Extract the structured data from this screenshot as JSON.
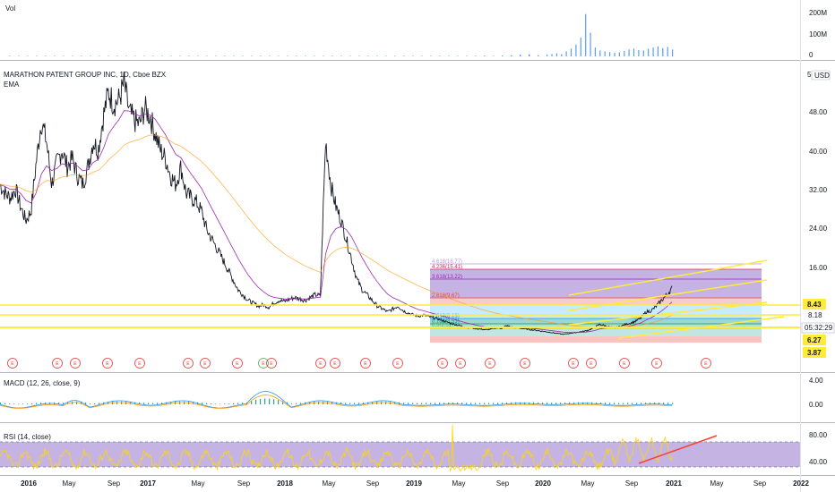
{
  "chart_data": [
    {
      "type": "bar",
      "panel": "volume",
      "legend": "Vol",
      "y_ticks": [
        "200M",
        "100M",
        "0"
      ],
      "ylim": [
        0,
        250
      ],
      "colors": {
        "bar": "#5b9cf6"
      },
      "series": [
        {
          "values": [
            0.5,
            0.6,
            0.4,
            0.5,
            0.3,
            0.4,
            0.6,
            0.5,
            0.4,
            0.3,
            0.4,
            0.5,
            0.6,
            0.7,
            0.5,
            0.4,
            0.3,
            0.4,
            0.5,
            0.6,
            0.5,
            0.4,
            0.8,
            1.2,
            0.9,
            0.6,
            0.5,
            0.4,
            0.3,
            0.4,
            0.5,
            0.6,
            0.5,
            0.4,
            0.3,
            0.5,
            0.6,
            0.7,
            0.5,
            0.4,
            0.6,
            1.0,
            1.8,
            2.5,
            1.2,
            0.8,
            0.6,
            0.5,
            0.8,
            1.1,
            0.9,
            1.5,
            2.0,
            3.0,
            2.2,
            4.0,
            6.0,
            8.0,
            10.0,
            6.0,
            9.0,
            12.0,
            15.0,
            11.0,
            25.0,
            40.0,
            60.0,
            95.0,
            215.0,
            120.0,
            45.0,
            30.0,
            25.0,
            22.0,
            18.0,
            20.0,
            28.0,
            35.0,
            40.0,
            32.0,
            30.0,
            38.0,
            45.0,
            50.0,
            42.0,
            48.0,
            35.0
          ]
        }
      ]
    },
    {
      "type": "line",
      "panel": "price",
      "title": "MARATHON PATENT GROUP INC, 1D, Cboe BZX",
      "legend": [
        "EMA"
      ],
      "currency": "USD",
      "y_ticks": [
        "5",
        "48.00",
        "40.00",
        "32.00",
        "24.00",
        "16.00",
        "8.43",
        "8.18",
        "05:32:29",
        "6.27",
        "3.87"
      ],
      "x_ticks": [
        "2016",
        "May",
        "Sep",
        "2017",
        "May",
        "Sep",
        "2018",
        "May",
        "Sep",
        "2019",
        "May",
        "Sep",
        "2020",
        "May",
        "Sep",
        "2021",
        "May",
        "Sep",
        "2022"
      ],
      "price_badges": {
        "upper": "8.43",
        "current": "8.18",
        "countdown": "05:32:29",
        "lower1": "6.27",
        "lower2": "3.87"
      },
      "horizontal_lines": [
        8.43,
        6.27,
        3.87
      ],
      "fib_levels": [
        {
          "label": "4.618(16.77)",
          "color": "#b39ddb"
        },
        {
          "label": "4.236(15.41)",
          "color": "#e91e63"
        },
        {
          "label": "3.618(13.22)",
          "color": "#9c27b0"
        },
        {
          "label": "2.618(9.67)",
          "color": "#f44336"
        },
        {
          "label": "1.618(6.13)",
          "color": "#2196f3"
        },
        {
          "label": "0.786(3.53)",
          "color": "#009688"
        },
        {
          "label": "0.5(2.51)",
          "color": "#4caf50"
        }
      ],
      "earnings_marker": "E",
      "series": [
        {
          "values": [
            30,
            28,
            27,
            29,
            25,
            22,
            24,
            35,
            45,
            40,
            30,
            35,
            38,
            34,
            36,
            32,
            30,
            34,
            40,
            38,
            46,
            52,
            49,
            50,
            54,
            47,
            45,
            44,
            48,
            46,
            42,
            38,
            36,
            32,
            30,
            34,
            28,
            27,
            26,
            24,
            20,
            18,
            16,
            14,
            12,
            10,
            8,
            7,
            6,
            5.5,
            5,
            5.2,
            4.8,
            5.5,
            6,
            5.8,
            6.2,
            6.5,
            6.3,
            6,
            6.5,
            7,
            6.8,
            40,
            30,
            25,
            22,
            18,
            14,
            10,
            8,
            7,
            6,
            5,
            4.5,
            4,
            4.5,
            5,
            4.2,
            3.8,
            3.5,
            3.3,
            3.5,
            3.2,
            3,
            2.8,
            2.5,
            2.2,
            2,
            1.8,
            1.6,
            1.5,
            1.4,
            1.3,
            1.2,
            1.3,
            1.5,
            1.4,
            1.8,
            1.6,
            1.5,
            1.4,
            1.3,
            1.2,
            1.1,
            1,
            0.9,
            0.8,
            0.7,
            0.6,
            0.7,
            0.8,
            0.9,
            1,
            1.2,
            1.5,
            2,
            1.8,
            1.6,
            1.5,
            1.7,
            2,
            2.2,
            2.5,
            3,
            4,
            4.2,
            5,
            6,
            7,
            8.18
          ]
        }
      ]
    },
    {
      "type": "line",
      "panel": "macd",
      "legend": "MACD (12, 26, close, 9)",
      "y_ticks": [
        "4.00",
        "0.00"
      ],
      "ylim": [
        -4,
        6
      ]
    },
    {
      "type": "line",
      "panel": "rsi",
      "legend": "RSI (14, close)",
      "y_ticks": [
        "80.00",
        "40.00"
      ],
      "ylim": [
        30,
        95
      ]
    }
  ]
}
